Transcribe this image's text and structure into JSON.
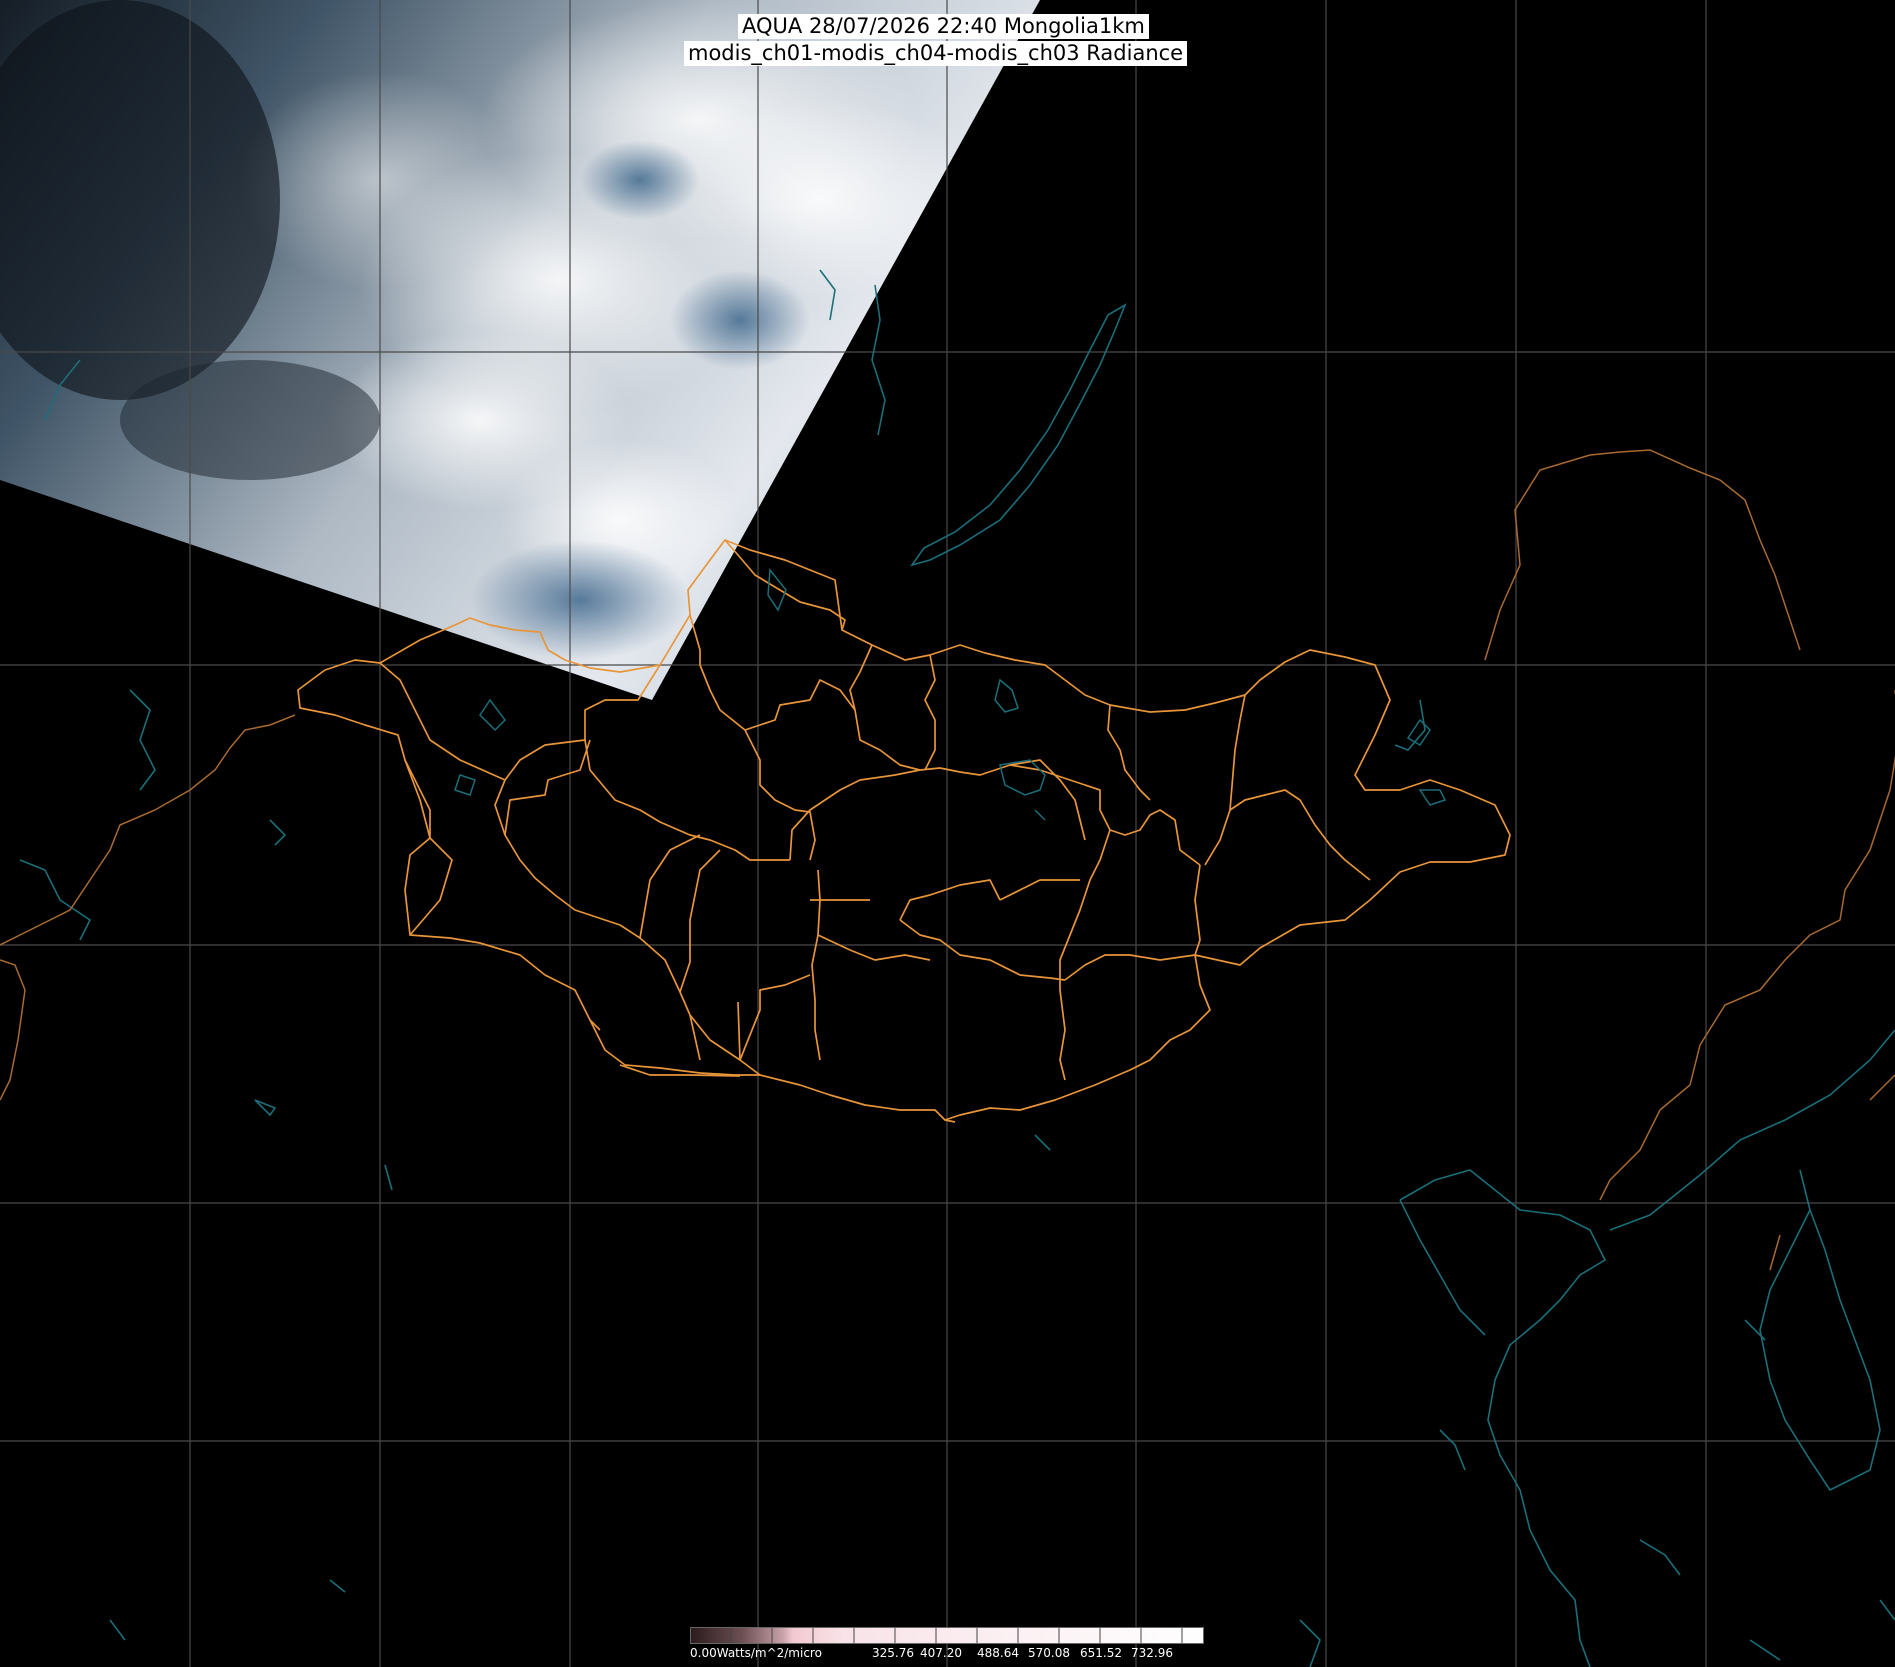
{
  "header": {
    "title_line1": "AQUA 28/07/2026 22:40 Mongolia1km",
    "title_line2": "modis_ch01-modis_ch04-modis_ch03 Radiance"
  },
  "colorbar": {
    "unit_label": "0.00Watts/m^2/micro",
    "tick_labels": [
      "325.76",
      "407.20",
      "488.64",
      "570.08",
      "651.52",
      "732.96"
    ]
  },
  "colors": {
    "background": "#000000",
    "graticule": "#4a4a4a",
    "coastline": "#1b6e7a",
    "country_border": "#a86a32",
    "province_border": "#e8953a"
  }
}
